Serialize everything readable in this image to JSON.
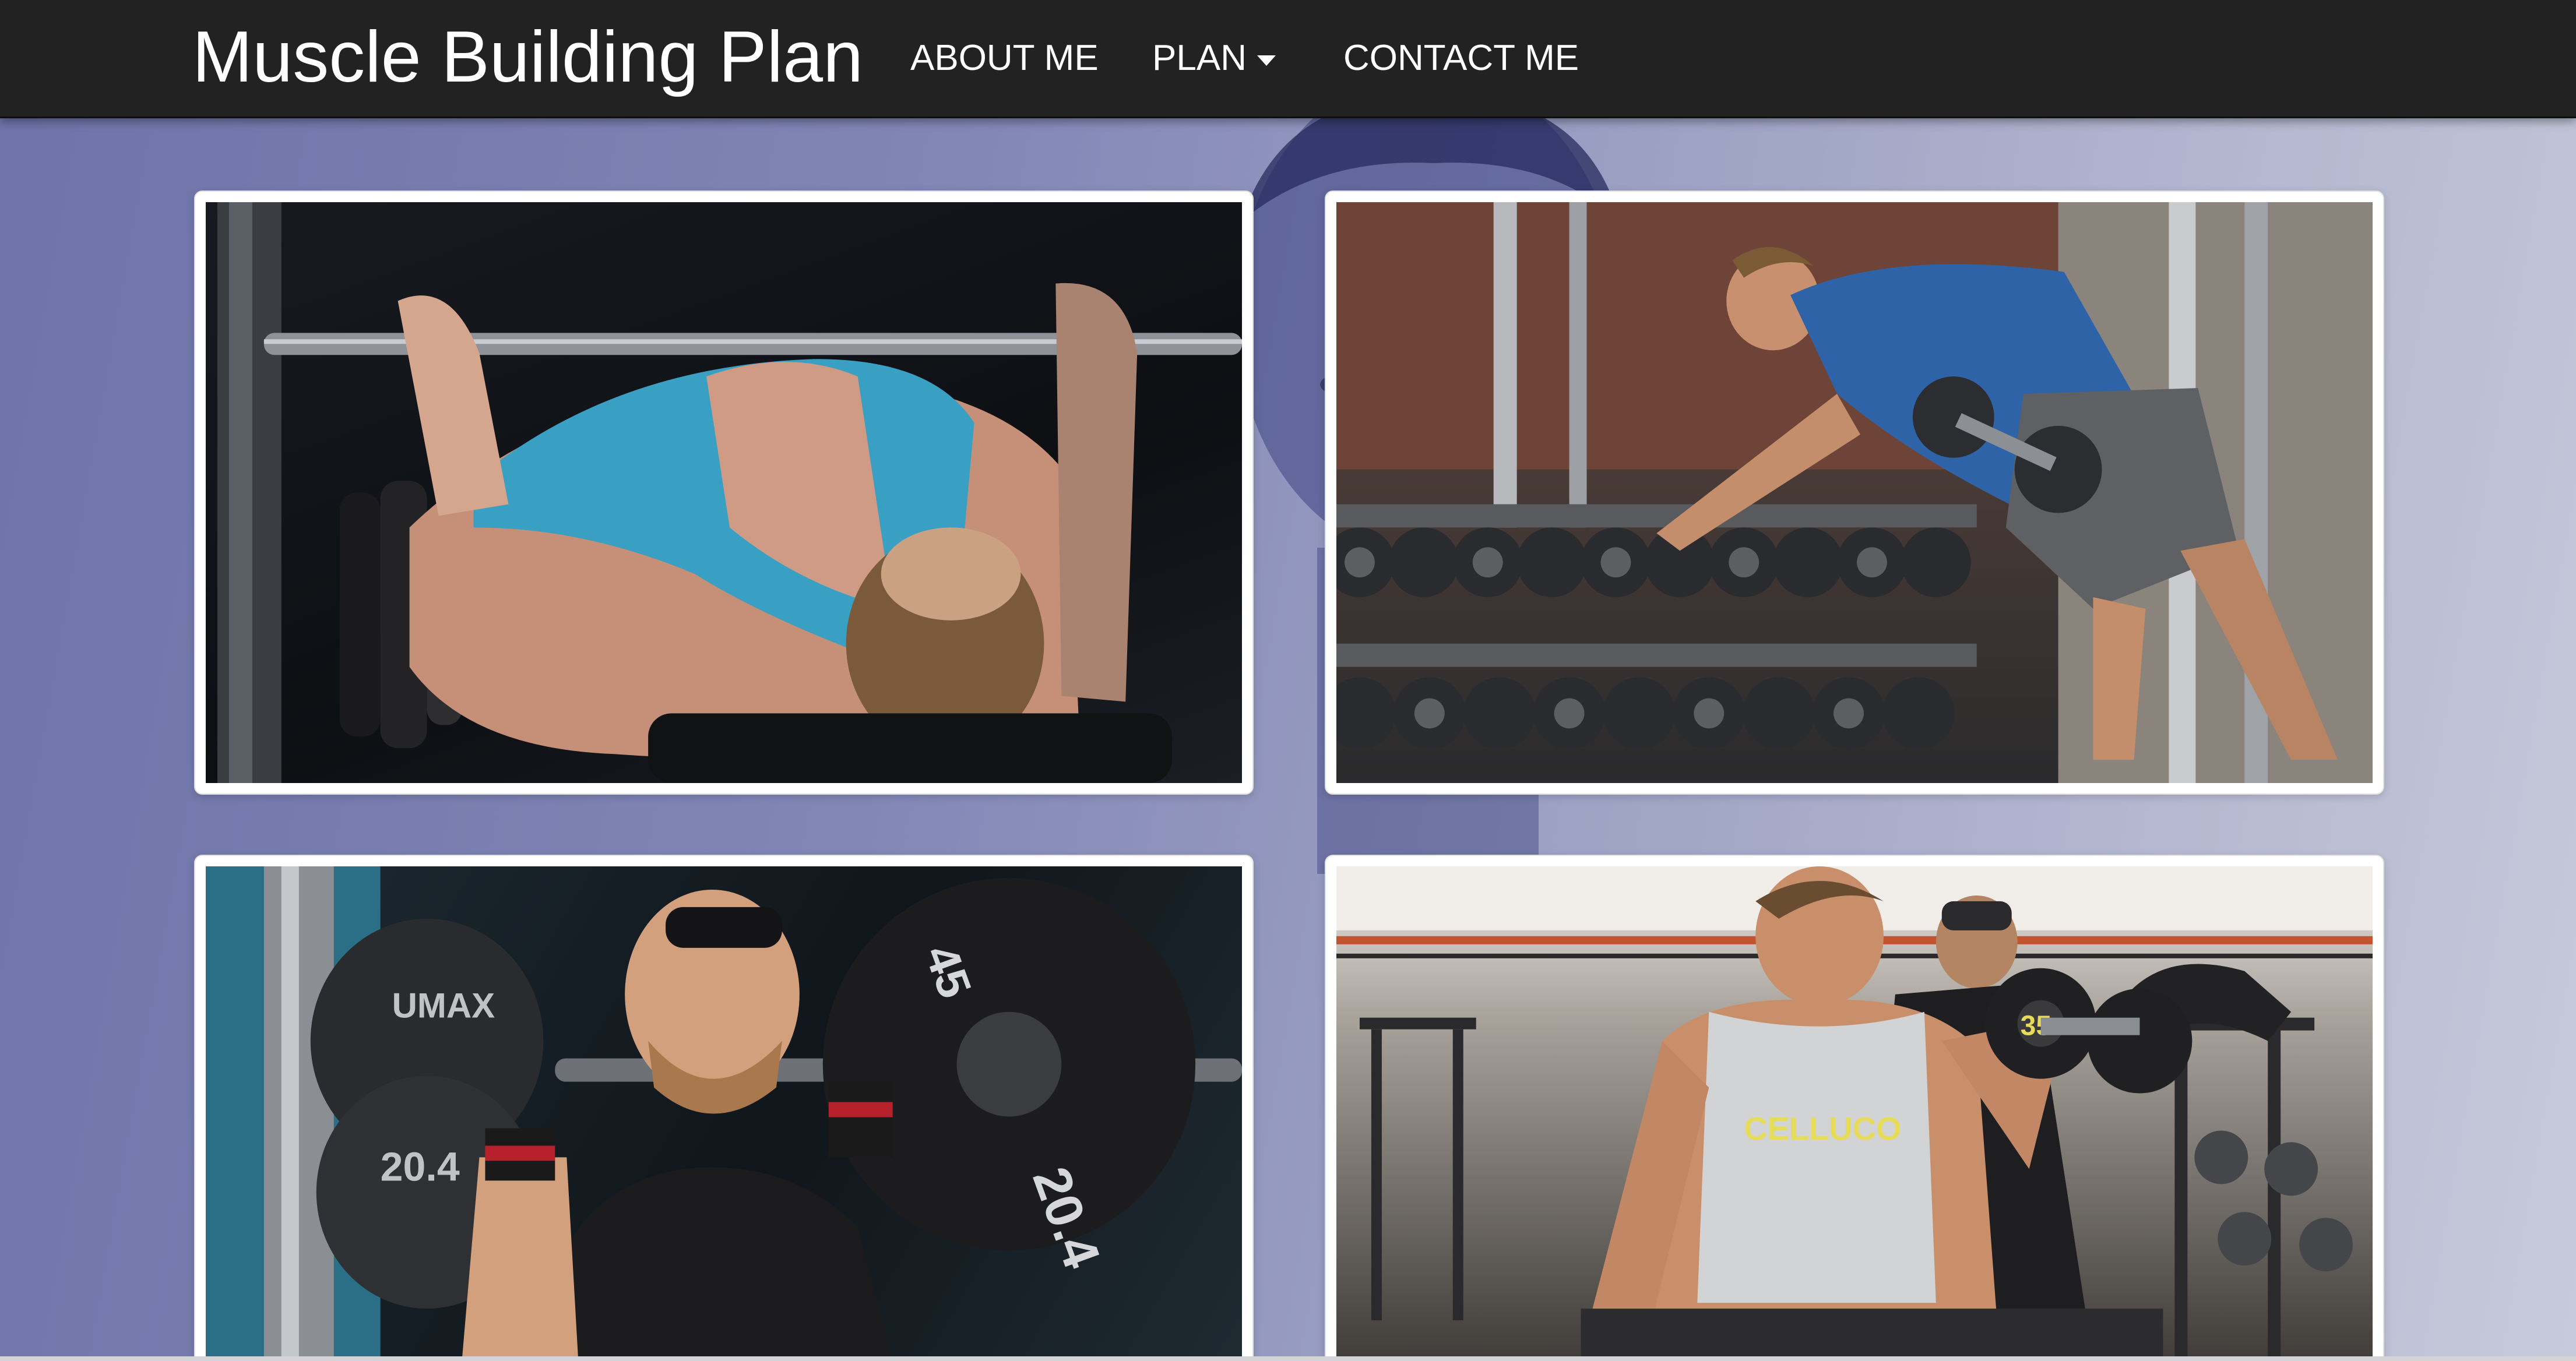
{
  "navbar": {
    "brand": "Muscle Building Plan",
    "items": [
      {
        "label": "ABOUT ME"
      },
      {
        "label": "PLAN",
        "has_dropdown": true
      },
      {
        "label": "CONTACT ME"
      }
    ],
    "background": "#222222",
    "text_color": "#ffffff"
  },
  "cards": [
    {
      "photo": "bench-press-photo",
      "plate_text": ""
    },
    {
      "photo": "dumbbell-row-photo",
      "plate_text": ""
    },
    {
      "photo": "barbell-squat-photo",
      "plate_text": [
        "45",
        "20.4",
        "UMAX",
        "20.4"
      ]
    },
    {
      "photo": "dumbbell-curl-photo",
      "plate_text": [
        "CELLUCO",
        "35"
      ]
    }
  ],
  "colors": {
    "page_background": "#8186b6",
    "card_border": "#ffffff"
  }
}
